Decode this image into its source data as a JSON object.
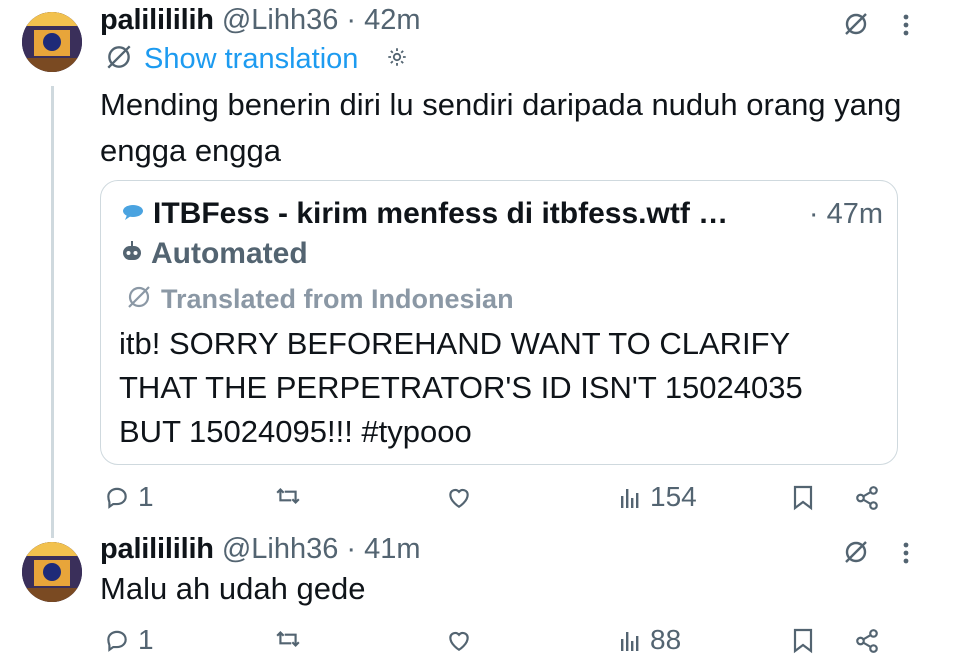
{
  "tweets": [
    {
      "name": "palilililih",
      "handle": "@Lihh36",
      "time": "· 42m",
      "translate_label": "Show translation",
      "text": "Mending benerin diri lu sendiri daripada nuduh orang yang engga engga",
      "quote": {
        "name": "ITBFess - kirim menfess di itbfess.wtf …",
        "time": "· 47m",
        "automated_label": "Automated",
        "translated_label": "Translated from Indonesian",
        "text": "itb! SORRY BEFOREHAND WANT TO CLARIFY THAT THE PERPETRATOR'S ID ISN'T 15024035 BUT 15024095!!! #typooo"
      },
      "actions": {
        "replies": "1",
        "reposts": "",
        "likes": "",
        "views": "154"
      }
    },
    {
      "name": "palilililih",
      "handle": "@Lihh36",
      "time": "· 41m",
      "text": "Malu ah udah gede",
      "actions": {
        "replies": "1",
        "reposts": "",
        "likes": "",
        "views": "88"
      }
    }
  ],
  "icons": {
    "translate": "translate-icon",
    "more": "more-icon",
    "settings": "gear-icon",
    "bot": "robot-icon",
    "reply": "reply-icon",
    "repost": "repost-icon",
    "like": "heart-icon",
    "views": "views-icon",
    "bookmark": "bookmark-icon",
    "share": "share-icon"
  },
  "colors": {
    "link": "#1d9bf0",
    "muted": "#536471",
    "text": "#0f1419",
    "border": "#cfd9de"
  }
}
